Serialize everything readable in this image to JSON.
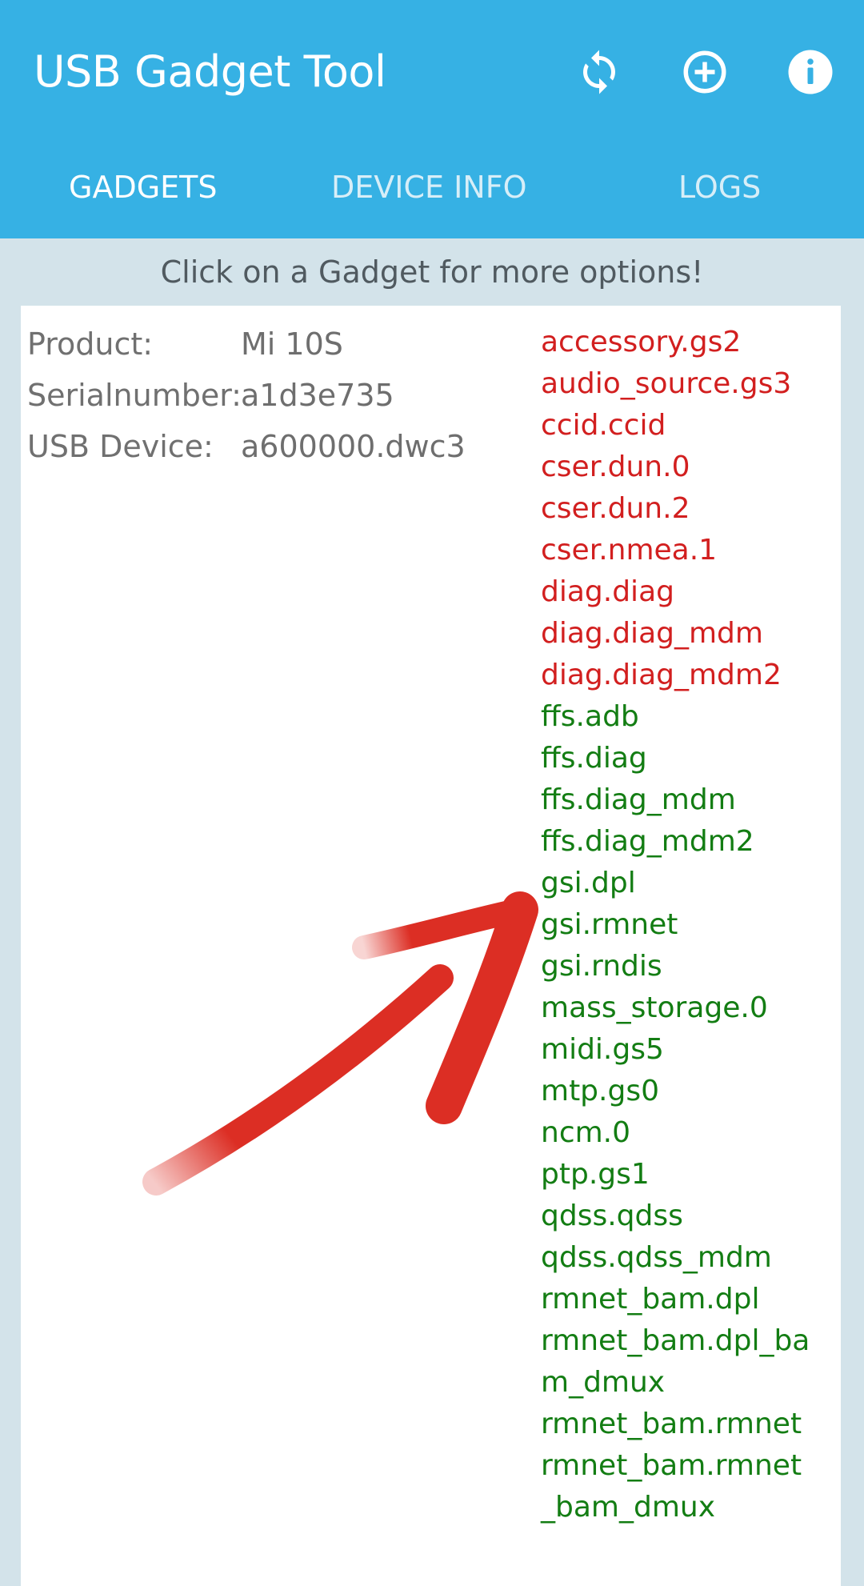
{
  "app": {
    "title": "USB Gadget Tool"
  },
  "toolbar": {
    "actions": [
      {
        "name": "refresh-icon"
      },
      {
        "name": "add-circle-icon"
      },
      {
        "name": "info-icon"
      }
    ]
  },
  "tabs": [
    {
      "label": "GADGETS",
      "active": true
    },
    {
      "label": "DEVICE INFO",
      "active": false
    },
    {
      "label": "LOGS",
      "active": false
    }
  ],
  "hint": "Click on a Gadget for more options!",
  "device": {
    "product_label": "Product:",
    "product_value": "Mi 10S",
    "serial_label": "Serialnumber:",
    "serial_value": "a1d3e735",
    "usb_label": "USB Device:",
    "usb_value": "a600000.dwc3"
  },
  "gadgets": [
    {
      "name": "accessory.gs2",
      "status": "inactive"
    },
    {
      "name": "audio_source.gs3",
      "status": "inactive"
    },
    {
      "name": "ccid.ccid",
      "status": "inactive"
    },
    {
      "name": "cser.dun.0",
      "status": "inactive"
    },
    {
      "name": "cser.dun.2",
      "status": "inactive"
    },
    {
      "name": "cser.nmea.1",
      "status": "inactive"
    },
    {
      "name": "diag.diag",
      "status": "inactive"
    },
    {
      "name": "diag.diag_mdm",
      "status": "inactive"
    },
    {
      "name": "diag.diag_mdm2",
      "status": "inactive"
    },
    {
      "name": "ffs.adb",
      "status": "active"
    },
    {
      "name": "ffs.diag",
      "status": "active"
    },
    {
      "name": "ffs.diag_mdm",
      "status": "active"
    },
    {
      "name": "ffs.diag_mdm2",
      "status": "active"
    },
    {
      "name": "gsi.dpl",
      "status": "active"
    },
    {
      "name": "gsi.rmnet",
      "status": "active"
    },
    {
      "name": "gsi.rndis",
      "status": "active"
    },
    {
      "name": "mass_storage.0",
      "status": "active"
    },
    {
      "name": "midi.gs5",
      "status": "active"
    },
    {
      "name": "mtp.gs0",
      "status": "active"
    },
    {
      "name": "ncm.0",
      "status": "active"
    },
    {
      "name": "ptp.gs1",
      "status": "active"
    },
    {
      "name": "qdss.qdss",
      "status": "active"
    },
    {
      "name": "qdss.qdss_mdm",
      "status": "active"
    },
    {
      "name": "rmnet_bam.dpl",
      "status": "active"
    },
    {
      "name": "rmnet_bam.dpl_ba",
      "status": "active"
    },
    {
      "name": "m_dmux",
      "status": "active"
    },
    {
      "name": "rmnet_bam.rmnet",
      "status": "active"
    },
    {
      "name": "rmnet_bam.rmnet",
      "status": "active"
    },
    {
      "name": "_bam_dmux",
      "status": "active"
    }
  ],
  "colors": {
    "appbar": "#36b1e4",
    "inactive_gadget": "#d21f1f",
    "active_gadget": "#137d13",
    "annotation_arrow": "#dc2e24"
  }
}
